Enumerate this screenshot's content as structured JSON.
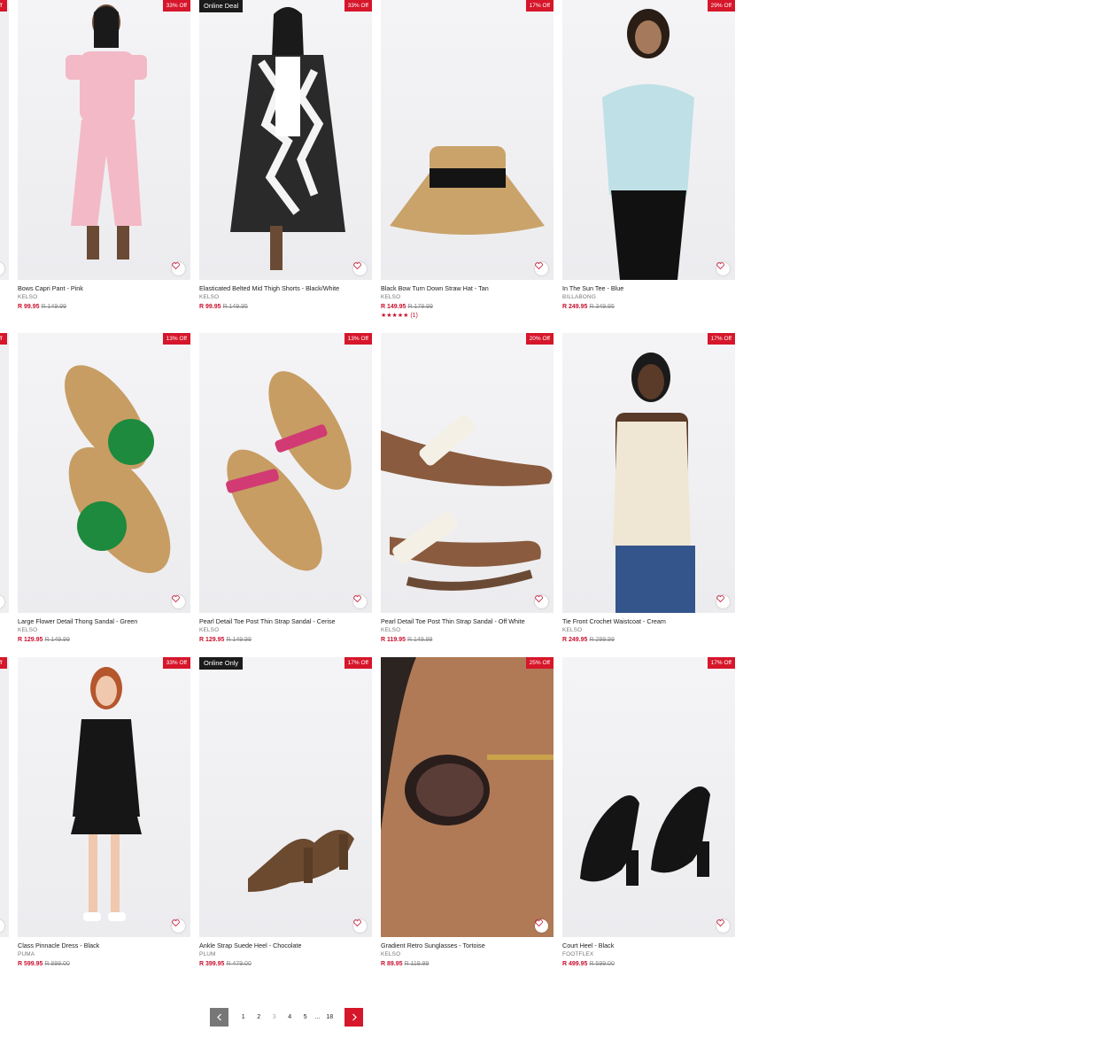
{
  "products": [
    {
      "title": "Bows Capri Pant - Pink",
      "brand": "KELSO",
      "price": "R 99.95",
      "was": "R 149.99",
      "badge": "33% Off",
      "deal": "",
      "rating": ""
    },
    {
      "title": "Elasticated Belted Mid Thigh Shorts - Black/White",
      "brand": "KELSO",
      "price": "R 99.95",
      "was": "R 149.95",
      "badge": "33% Off",
      "deal": "Online Deal",
      "rating": ""
    },
    {
      "title": "Black Bow Turn Down Straw Hat - Tan",
      "brand": "KELSO",
      "price": "R 149.95",
      "was": "R 179.99",
      "badge": "17% Off",
      "deal": "",
      "rating": "★★★★★ (1)"
    },
    {
      "title": "In The Sun Tee - Blue",
      "brand": "BILLABONG",
      "price": "R 249.95",
      "was": "R 349.95",
      "badge": "29% Off",
      "deal": "",
      "rating": ""
    },
    {
      "title": "Large Flower Detail Thong Sandal - Green",
      "brand": "KELSO",
      "price": "R 129.95",
      "was": "R 149.99",
      "badge": "13% Off",
      "deal": "",
      "rating": ""
    },
    {
      "title": "Pearl Detail Toe Post Thin Strap Sandal - Cerise",
      "brand": "KELSO",
      "price": "R 129.95",
      "was": "R 149.99",
      "badge": "13% Off",
      "deal": "",
      "rating": ""
    },
    {
      "title": "Pearl Detail Toe Post Thin Strap Sandal - Off White",
      "brand": "KELSO",
      "price": "R 119.95",
      "was": "R 149.99",
      "badge": "20% Off",
      "deal": "",
      "rating": ""
    },
    {
      "title": "Tie Front Crochet Waistcoat - Cream",
      "brand": "KELSO",
      "price": "R 249.95",
      "was": "R 299.99",
      "badge": "17% Off",
      "deal": "",
      "rating": ""
    },
    {
      "title": "Class Pinnacle Dress - Black",
      "brand": "PUMA",
      "price": "R 599.95",
      "was": "R 899.00",
      "badge": "33% Off",
      "deal": "",
      "rating": ""
    },
    {
      "title": "Ankle Strap Suede Heel - Chocolate",
      "brand": "PLUM",
      "price": "R 399.95",
      "was": "R 479.00",
      "badge": "17% Off",
      "deal": "Online Only",
      "rating": ""
    },
    {
      "title": "Gradient Retro Sunglasses - Tortoise",
      "brand": "KELSO",
      "price": "R 89.95",
      "was": "R 119.99",
      "badge": "25% Off",
      "deal": "",
      "rating": ""
    },
    {
      "title": "Court Heel - Black",
      "brand": "FOOTFLEX",
      "price": "R 499.95",
      "was": "R 599.00",
      "badge": "17% Off",
      "deal": "",
      "rating": ""
    }
  ],
  "pagination": {
    "pages": [
      "1",
      "2",
      "3",
      "4",
      "5",
      "...",
      "18"
    ],
    "current": "3"
  },
  "colors": {
    "accent": "#d6162a",
    "price": "#c8102e",
    "deal_bg": "#1b1b1b"
  }
}
